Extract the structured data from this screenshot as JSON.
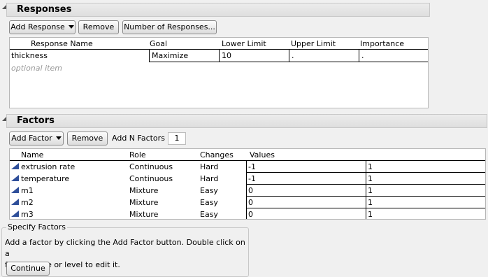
{
  "responses": {
    "title": "Responses",
    "add_response_label": "Add Response",
    "remove_label": "Remove",
    "number_of_responses_label": "Number of Responses...",
    "columns": [
      "Response Name",
      "Goal",
      "Lower Limit",
      "Upper Limit",
      "Importance"
    ],
    "rows": [
      {
        "name": "thickness",
        "goal": "Maximize",
        "lower": "10",
        "upper": ".",
        "importance": "."
      }
    ],
    "optional_item": "optional item"
  },
  "factors": {
    "title": "Factors",
    "add_factor_label": "Add Factor",
    "remove_label": "Remove",
    "add_n_factors_label": "Add N Factors",
    "n_factors_value": "1",
    "columns": [
      "Name",
      "Role",
      "Changes",
      "Values"
    ],
    "rows": [
      {
        "name": "extrusion rate",
        "role": "Continuous",
        "changes": "Hard",
        "low": "-1",
        "high": "1"
      },
      {
        "name": "temperature",
        "role": "Continuous",
        "changes": "Hard",
        "low": "-1",
        "high": "1"
      },
      {
        "name": "m1",
        "role": "Mixture",
        "changes": "Easy",
        "low": "0",
        "high": "1"
      },
      {
        "name": "m2",
        "role": "Mixture",
        "changes": "Easy",
        "low": "0",
        "high": "1"
      },
      {
        "name": "m3",
        "role": "Mixture",
        "changes": "Easy",
        "low": "0",
        "high": "1"
      }
    ],
    "icon": "continuous-factor-icon"
  },
  "specify_factors": {
    "title": "Specify Factors",
    "text_line1": "Add a factor by clicking the Add Factor button. Double click on a",
    "text_line2": "factor name or level to edit it.",
    "continue_label": "Continue"
  },
  "colors": {
    "factor_icon": "#2f4f9a",
    "section_header": "#e4e4e4"
  }
}
